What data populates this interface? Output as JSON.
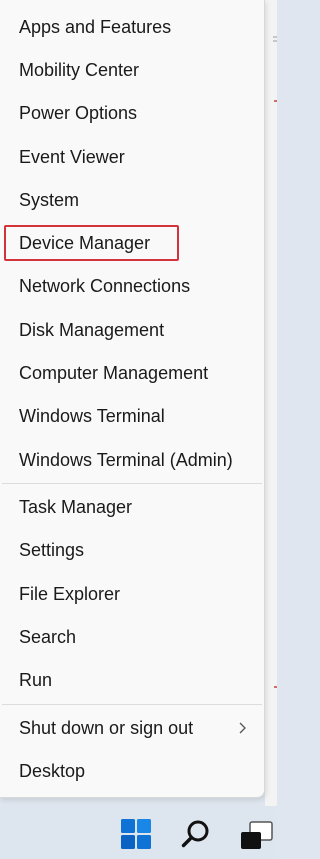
{
  "menu": {
    "items": [
      {
        "label": "Apps and Features"
      },
      {
        "label": "Mobility Center"
      },
      {
        "label": "Power Options"
      },
      {
        "label": "Event Viewer"
      },
      {
        "label": "System"
      },
      {
        "label": "Device Manager"
      },
      {
        "label": "Network Connections"
      },
      {
        "label": "Disk Management"
      },
      {
        "label": "Computer Management"
      },
      {
        "label": "Windows Terminal"
      },
      {
        "label": "Windows Terminal (Admin)"
      },
      {
        "label": "Task Manager"
      },
      {
        "label": "Settings"
      },
      {
        "label": "File Explorer"
      },
      {
        "label": "Search"
      },
      {
        "label": "Run"
      },
      {
        "label": "Shut down or sign out"
      },
      {
        "label": "Desktop"
      }
    ],
    "highlighted": "Device Manager",
    "highlight_color": "#d3343b"
  },
  "taskbar": {
    "icons": [
      "windows-start-icon",
      "search-icon",
      "task-view-icon"
    ],
    "start_color": "#0f73d6"
  }
}
